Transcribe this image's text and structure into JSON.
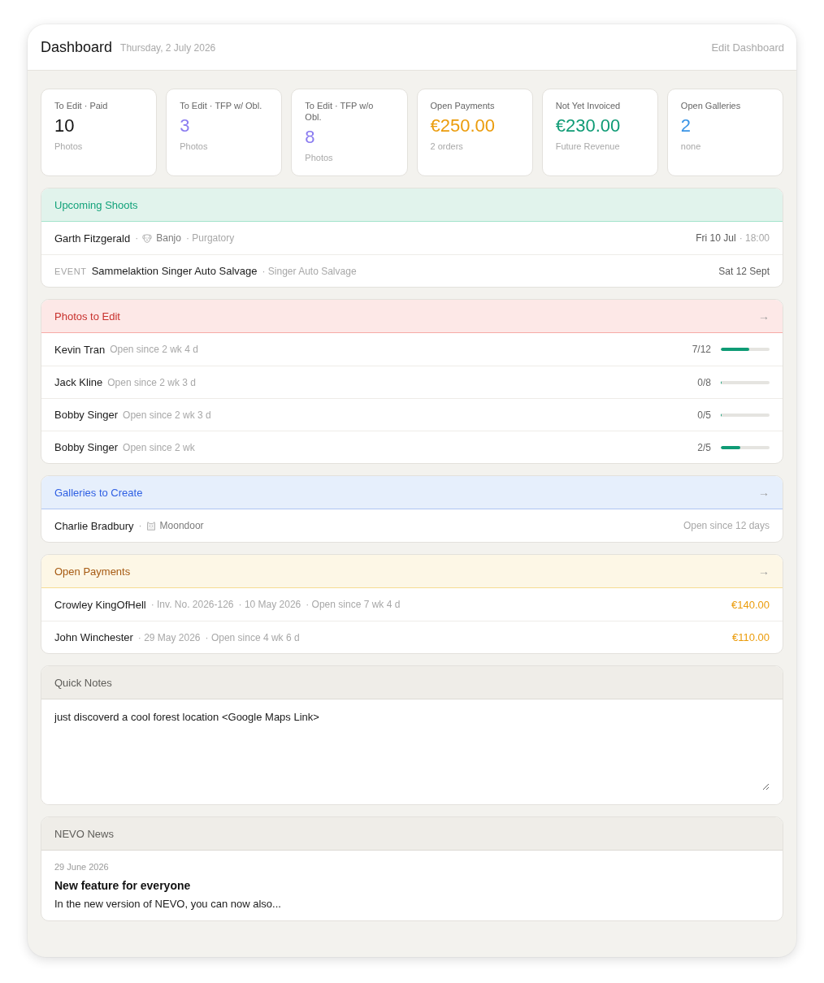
{
  "header": {
    "title": "Dashboard",
    "date": "Thursday, 2 July 2026",
    "action": "Edit Dashboard"
  },
  "stats": [
    {
      "label": "To Edit · Paid",
      "value": "10",
      "caption": "Photos",
      "color": "#141414"
    },
    {
      "label": "To Edit · TFP w/ Obl.",
      "value": "3",
      "caption": "Photos",
      "color": "#8b7cf0"
    },
    {
      "label": "To Edit · TFP w/o Obl.",
      "value": "8",
      "caption": "Photos",
      "color": "#8b7cf0"
    },
    {
      "label": "Open Payments",
      "value": "€250.00",
      "caption": "2 orders",
      "color": "#eb9c0c"
    },
    {
      "label": "Not Yet Invoiced",
      "value": "€230.00",
      "caption": "Future Revenue",
      "color": "#0f9b75"
    },
    {
      "label": "Open Galleries",
      "value": "2",
      "caption": "none",
      "color": "#3a94e6"
    }
  ],
  "sections": [
    {
      "kind": "shoots",
      "title": "Upcoming Shoots",
      "color": "#13a27a",
      "rows": [
        {
          "name": "Garth Fitzgerald",
          "details": [
            {
              "kind": "dog",
              "sep": "·",
              "text": "Banjo"
            },
            {
              "kind": "plain",
              "text": "· Purgatory"
            }
          ],
          "date": "Fri 10 Jul",
          "time": "· 18:00"
        },
        {
          "tag": "EVENT",
          "name": "Sammelaktion Singer Auto Salvage",
          "details": [
            {
              "kind": "plain",
              "text": "· Singer Auto Salvage"
            }
          ],
          "date": "Sat 12 Sept"
        }
      ]
    },
    {
      "kind": "progress",
      "title": "Photos to Edit",
      "color": "#c8312d",
      "arrow": "→",
      "rows": [
        {
          "name": "Kevin Tran",
          "since": "Open since 2 wk 4 d",
          "count": "7/12",
          "level": 0.58
        },
        {
          "name": "Jack Kline",
          "since": "Open since 2 wk 3 d",
          "count": "0/8",
          "level": 0
        },
        {
          "name": "Bobby Singer",
          "since": "Open since 2 wk 3 d",
          "count": "0/5",
          "level": 0
        },
        {
          "name": "Bobby Singer",
          "since": "Open since 2 wk",
          "count": "2/5",
          "level": 0.4
        }
      ]
    },
    {
      "kind": "galleries",
      "title": "Galleries to Create",
      "color": "#2e5fe3",
      "arrow": "→",
      "rows": [
        {
          "name": "Charlie Bradbury",
          "details": [
            {
              "kind": "cat",
              "sep": "·",
              "text": "Moondoor"
            }
          ],
          "since": "Open since 12 days"
        }
      ]
    },
    {
      "kind": "payments",
      "title": "Open Payments",
      "color": "#a65a12",
      "arrow": "→",
      "rows": [
        {
          "name": "Crowley KingOfHell",
          "details": [
            {
              "kind": "plain",
              "text": "· Inv. No. 2026-126"
            },
            {
              "kind": "plain",
              "text": "· 10 May 2026"
            },
            {
              "kind": "plain",
              "text": "· Open since 7 wk 4 d"
            }
          ],
          "amount": "€140.00"
        },
        {
          "name": "John Winchester",
          "details": [
            {
              "kind": "plain",
              "text": "· 29 May 2026"
            },
            {
              "kind": "plain",
              "text": "· Open since 4 wk 6 d"
            }
          ],
          "amount": "€110.00"
        }
      ]
    },
    {
      "kind": "notes",
      "title": "Quick Notes",
      "color": "#5e5d59",
      "value": "just discoverd a cool forest location <Google Maps Link>"
    },
    {
      "kind": "news",
      "title": "NEVO News",
      "color": "#5e5d59",
      "date": "29 June 2026",
      "headline": "New feature for everyone",
      "text": "In the new version of NEVO, you can now also..."
    }
  ]
}
